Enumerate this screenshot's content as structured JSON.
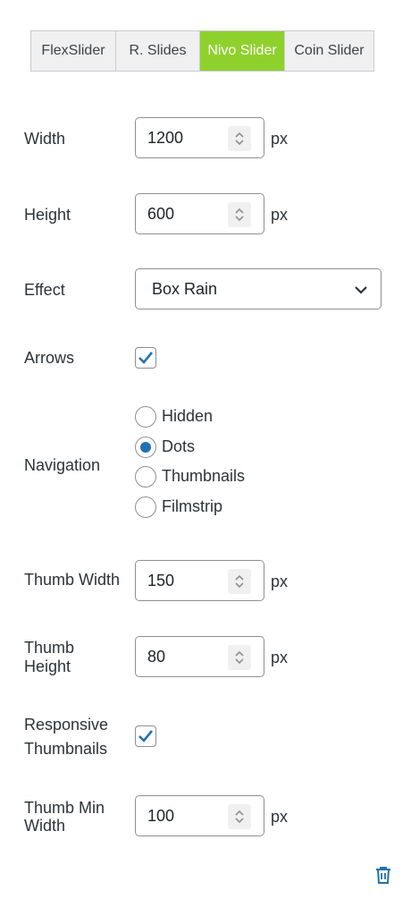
{
  "tabs": [
    {
      "label": "FlexSlider",
      "active": false
    },
    {
      "label": "R. Slides",
      "active": false
    },
    {
      "label": "Nivo Slider",
      "active": true
    },
    {
      "label": "Coin Slider",
      "active": false
    }
  ],
  "colors": {
    "active_tab": "#8fd12c",
    "accent": "#2271b1"
  },
  "fields": {
    "width": {
      "label": "Width",
      "value": "1200",
      "unit": "px"
    },
    "height": {
      "label": "Height",
      "value": "600",
      "unit": "px"
    },
    "effect": {
      "label": "Effect",
      "value": "Box Rain"
    },
    "arrows": {
      "label": "Arrows",
      "checked": true
    },
    "navigation": {
      "label": "Navigation",
      "options": [
        "Hidden",
        "Dots",
        "Thumbnails",
        "Filmstrip"
      ],
      "selected": "Dots"
    },
    "thumb_width": {
      "label": "Thumb Width",
      "value": "150",
      "unit": "px"
    },
    "thumb_height": {
      "label_line1": "Thumb",
      "label_line2": "Height",
      "value": "80",
      "unit": "px"
    },
    "responsive_thumbnails": {
      "label_line1": "Responsive",
      "label_line2": "Thumbnails",
      "checked": true
    },
    "thumb_min_width": {
      "label_line1": "Thumb Min",
      "label_line2": "Width",
      "value": "100",
      "unit": "px"
    }
  },
  "icons": {
    "spinner": "chevron-updown-icon",
    "select": "chevron-down-icon",
    "check": "checkmark-icon",
    "delete": "trash-icon"
  }
}
